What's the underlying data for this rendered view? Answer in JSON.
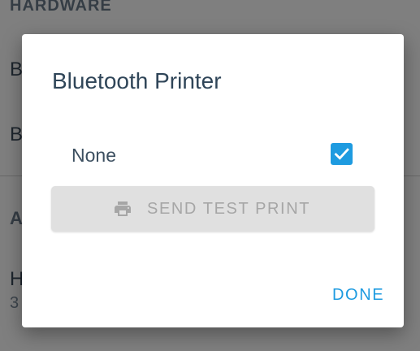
{
  "background": {
    "section_header": "HARDWARE",
    "row1_partial": "B",
    "row2_partial": "B",
    "section2_partial": "A",
    "row3_partial": "H",
    "row3_sub_partial": "3",
    "row1_right_partial": "‹",
    "row2_right_partial": "‹"
  },
  "dialog": {
    "title": "Bluetooth Printer",
    "option": {
      "label": "None",
      "checked": true
    },
    "test_print_button": {
      "label": "SEND TEST PRINT",
      "icon": "printer-icon",
      "enabled": false
    },
    "done_button": {
      "label": "DONE"
    }
  },
  "colors": {
    "accent": "#1e9be0",
    "scrim": "rgba(0,0,0,0.5)",
    "disabled_button_bg": "#e0e0e0",
    "disabled_text": "#a6a6a6"
  }
}
